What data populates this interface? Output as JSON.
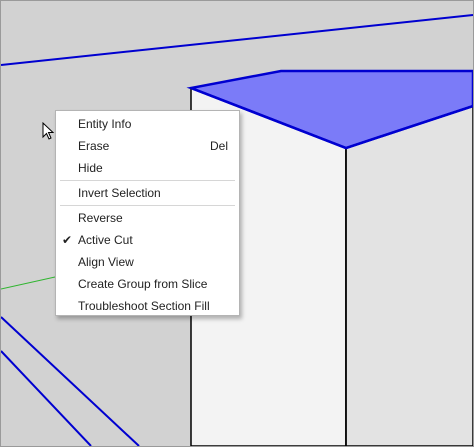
{
  "colors": {
    "background": "#d2d2d2",
    "box_top_face": "#7b7bf8",
    "box_front_face": "#f3f3f3",
    "box_side_face": "#e3e3e3",
    "selected_edge": "#0000d0",
    "axis_green": "#2fb52f",
    "menu_bg": "#ffffff"
  },
  "context_menu": {
    "items": [
      {
        "label": "Entity Info",
        "shortcut": ""
      },
      {
        "label": "Erase",
        "shortcut": "Del"
      },
      {
        "label": "Hide",
        "shortcut": ""
      },
      {
        "label": "Invert Selection",
        "shortcut": ""
      },
      {
        "label": "Reverse",
        "shortcut": ""
      },
      {
        "label": "Active Cut",
        "shortcut": "",
        "checked": true
      },
      {
        "label": "Align View",
        "shortcut": ""
      },
      {
        "label": "Create Group from Slice",
        "shortcut": ""
      },
      {
        "label": "Troubleshoot Section Fill",
        "shortcut": ""
      }
    ],
    "check_mark": "✔"
  },
  "cursor": {
    "icon": "arrow-pointer-icon"
  }
}
